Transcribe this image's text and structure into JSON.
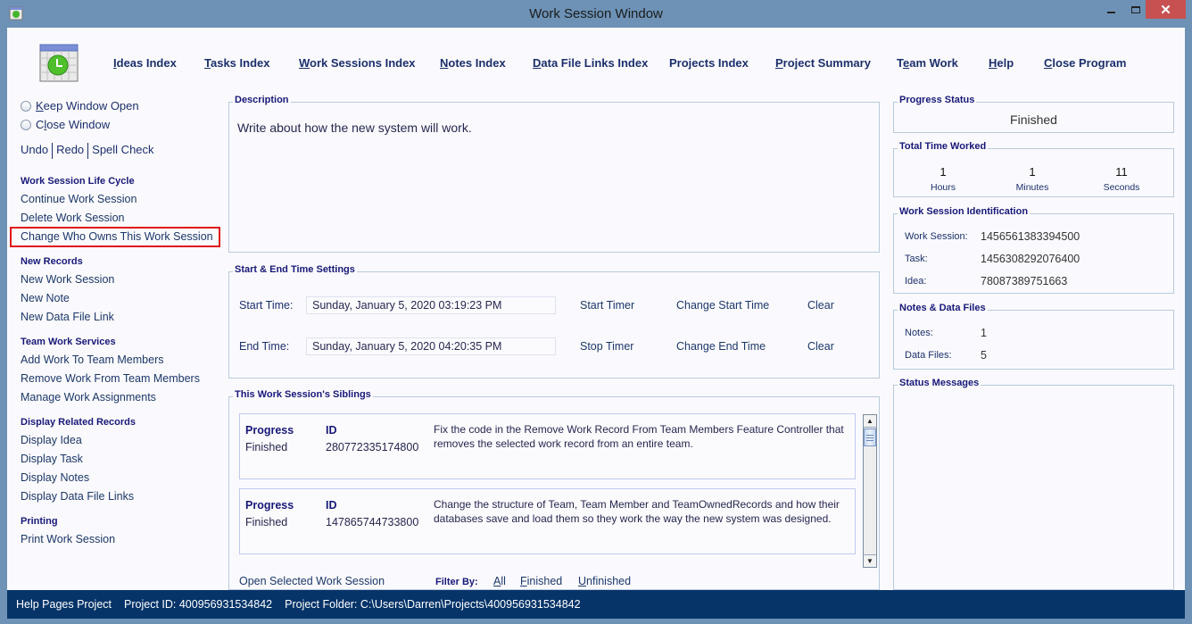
{
  "window": {
    "title": "Work Session Window",
    "minimize_icon": "minimize-icon",
    "maximize_icon": "maximize-icon",
    "close_icon": "close-icon",
    "close_glyph": "✕"
  },
  "logo_icon": "calendar-clock-icon",
  "topnav": [
    {
      "key": "I",
      "rest": "deas Index"
    },
    {
      "key": "T",
      "rest": "asks Index"
    },
    {
      "key": "W",
      "rest": "ork Sessions Index"
    },
    {
      "key": "N",
      "rest": "otes Index"
    },
    {
      "key": "D",
      "rest": "ata File Links Index"
    },
    {
      "key": "",
      "rest": "Projects Index"
    },
    {
      "key": "P",
      "rest": "roject Summary"
    },
    {
      "pre": "T",
      "key": "e",
      "rest": "am Work"
    },
    {
      "key": "H",
      "rest": "elp"
    },
    {
      "key": "C",
      "rest": "lose Program"
    }
  ],
  "sidebar": {
    "radios": [
      {
        "key": "K",
        "rest": "eep Window Open"
      },
      {
        "pre": "C",
        "key": "l",
        "rest": "ose Window"
      }
    ],
    "edit": [
      "Undo",
      "Redo",
      "Spell Check"
    ],
    "sections": [
      {
        "title": "Work Session Life Cycle",
        "items": [
          "Continue Work Session",
          "Delete Work Session",
          "Change Who Owns This Work Session"
        ]
      },
      {
        "title": "New Records",
        "items": [
          "New Work Session",
          "New Note",
          "New Data File Link"
        ]
      },
      {
        "title": "Team Work Services",
        "items": [
          "Add Work To Team Members",
          "Remove Work From Team Members",
          "Manage Work Assignments"
        ]
      },
      {
        "title": "Display Related Records",
        "items": [
          "Display Idea",
          "Display Task",
          "Display Notes",
          "Display Data File Links"
        ]
      },
      {
        "title": "Printing",
        "items": [
          "Print Work Session"
        ]
      }
    ],
    "highlight_color": "#e0151b"
  },
  "description": {
    "title": "Description",
    "text": "Write about how the new system will work."
  },
  "times": {
    "title": "Start & End Time Settings",
    "start_label": "Start Time:",
    "start_value": "Sunday, January 5, 2020   03:19:23 PM",
    "start_timer": "Start Timer",
    "change_start": "Change Start Time",
    "clear_start": "Clear",
    "end_label": "End Time:",
    "end_value": "Sunday, January 5, 2020   04:20:35 PM",
    "stop_timer": "Stop Timer",
    "change_end": "Change End Time",
    "clear_end": "Clear"
  },
  "siblings": {
    "title": "This Work Session's Siblings",
    "progress_header": "Progress",
    "id_header": "ID",
    "items": [
      {
        "progress": "Finished",
        "id": "280772335174800",
        "description": "Fix the code in the Remove Work Record From Team Members Feature Controller that removes the selected work record from an entire team."
      },
      {
        "progress": "Finished",
        "id": "147865744733800",
        "description": "Change the structure of Team, Team Member and TeamOwnedRecords and how their databases save and load them so they work the way the new system was designed."
      }
    ],
    "open_selected": "Open Selected Work Session",
    "filter_label": "Filter By:",
    "filters": [
      {
        "key": "A",
        "rest": "ll"
      },
      {
        "key": "F",
        "rest": "inished"
      },
      {
        "key": "U",
        "rest": "nfinished"
      }
    ]
  },
  "right": {
    "progress_title": "Progress Status",
    "progress_value": "Finished",
    "time_title": "Total Time Worked",
    "hours": "1",
    "hours_label": "Hours",
    "minutes": "1",
    "minutes_label": "Minutes",
    "seconds": "11",
    "seconds_label": "Seconds",
    "ident_title": "Work Session Identification",
    "ws_label": "Work Session:",
    "ws_value": "1456561383394500",
    "task_label": "Task:",
    "task_value": "1456308292076400",
    "idea_label": "Idea:",
    "idea_value": "78087389751663",
    "notes_title": "Notes & Data Files",
    "notes_label": "Notes:",
    "notes_value": "1",
    "files_label": "Data Files:",
    "files_value": "5",
    "status_title": "Status Messages"
  },
  "statusbar": {
    "project": "Help Pages Project",
    "project_id": "Project ID:  400956931534842",
    "folder": "Project Folder: C:\\Users\\Darren\\Projects\\400956931534842"
  }
}
